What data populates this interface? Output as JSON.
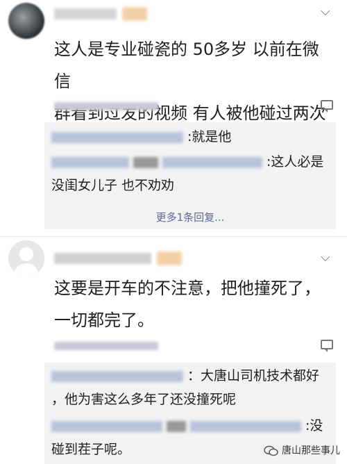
{
  "comments": [
    {
      "text_lines": [
        "这人是专业碰瓷的 50多岁 以前在微信",
        "群看到过发的视频 有人被他碰过两次"
      ],
      "replies": [
        {
          "text": ":就是他"
        },
        {
          "text": ":这人必是"
        },
        {
          "text": "没闺女儿子 也不劝劝"
        }
      ],
      "more_replies": "更多1条回复..."
    },
    {
      "text_lines": [
        "这要是开车的不注意，把他撞死了，",
        "一切都完了。"
      ],
      "replies": [
        {
          "text": "：大唐山司机技术都好"
        },
        {
          "text": "，他为害这么多年了还没撞死呢"
        },
        {
          "text": ":没"
        },
        {
          "text": "碰到茬子呢。"
        }
      ]
    }
  ],
  "watermark": {
    "text": "唐山那些事儿",
    "icon": "wechat-icon"
  },
  "colors": {
    "link": "#596a9a",
    "reply_bg": "#f2f2f2"
  }
}
